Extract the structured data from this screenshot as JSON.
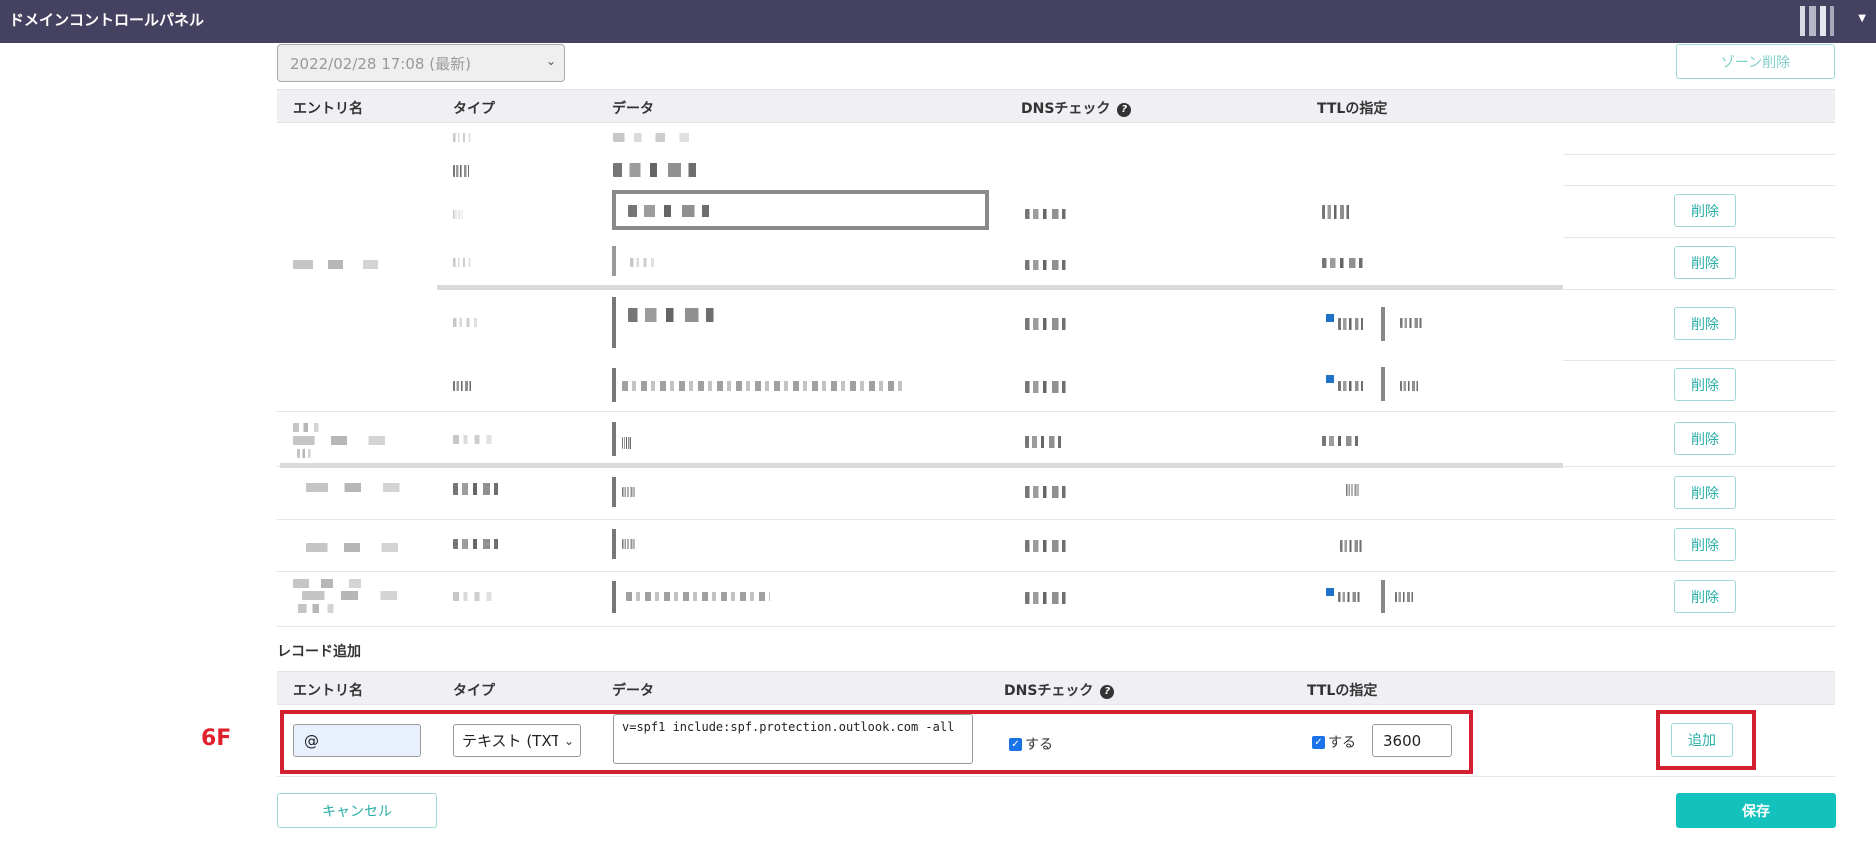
{
  "app": {
    "title": "ドメインコントロールパネル"
  },
  "zone": {
    "version_selected": "2022/02/28 17:08 (最新)",
    "zone_delete_label": "ゾーン削除"
  },
  "table": {
    "headers": {
      "entry": "エントリ名",
      "type": "タイプ",
      "data": "データ",
      "dns_check": "DNSチェック",
      "ttl": "TTLの指定"
    },
    "delete_label": "削除"
  },
  "add_record": {
    "section_title": "レコード追加",
    "headers": {
      "entry": "エントリ名",
      "type": "タイプ",
      "data": "データ",
      "dns_check": "DNSチェック",
      "ttl": "TTLの指定"
    },
    "entry_value": "@",
    "type_value": "テキスト (TXT)",
    "data_value": "v=spf1 include:spf.protection.outlook.com -all",
    "dns_check_label": "する",
    "dns_check_checked": true,
    "ttl_check_label": "する",
    "ttl_check_checked": true,
    "ttl_value": "3600",
    "add_label": "追加"
  },
  "annotation": {
    "label": "6F",
    "color": "#d22030"
  },
  "footer": {
    "cancel_label": "キャンセル",
    "save_label": "保存"
  },
  "colors": {
    "topbar": "#454261",
    "accent": "#13c2bd",
    "highlight": "#d22030"
  }
}
